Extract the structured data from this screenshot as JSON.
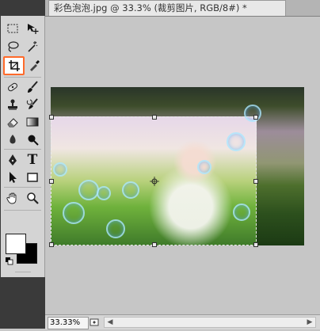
{
  "document_tab": {
    "title": "彩色泡泡.jpg @ 33.3% (裁剪图片, RGB/8#) *"
  },
  "toolbar": {
    "tools": [
      {
        "name": "marquee-tool-icon"
      },
      {
        "name": "move-tool-icon"
      },
      {
        "name": "lasso-tool-icon"
      },
      {
        "name": "magic-wand-tool-icon"
      },
      {
        "name": "crop-tool-icon",
        "selected": true
      },
      {
        "name": "eyedropper-tool-icon"
      },
      {
        "name": "healing-brush-tool-icon"
      },
      {
        "name": "brush-tool-icon"
      },
      {
        "name": "clone-stamp-tool-icon"
      },
      {
        "name": "history-brush-tool-icon"
      },
      {
        "name": "eraser-tool-icon"
      },
      {
        "name": "gradient-tool-icon"
      },
      {
        "name": "blur-tool-icon"
      },
      {
        "name": "dodge-tool-icon"
      },
      {
        "name": "pen-tool-icon"
      },
      {
        "name": "type-tool-icon",
        "label": "T"
      },
      {
        "name": "path-selection-tool-icon"
      },
      {
        "name": "rectangle-tool-icon"
      },
      {
        "name": "hand-tool-icon"
      },
      {
        "name": "zoom-tool-icon"
      }
    ],
    "foreground_color": "#ffffff",
    "background_color": "#000000"
  },
  "status": {
    "zoom": "33.33%"
  },
  "colors": {
    "selected_outline": "#ff6a2b",
    "canvas_bg": "#c6c6c6"
  }
}
